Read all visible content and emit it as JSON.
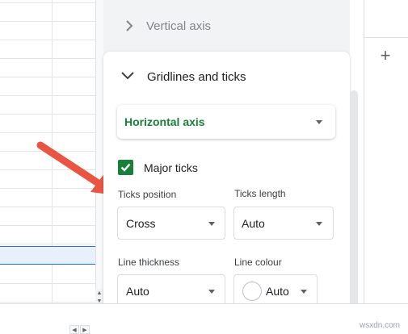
{
  "editor": {
    "vertical_axis_section": "Vertical axis",
    "gridlines_section": "Gridlines and ticks",
    "axis_select_value": "Horizontal axis",
    "major_ticks_label": "Major ticks",
    "major_ticks_checked": true,
    "ticks_position": {
      "label": "Ticks position",
      "value": "Cross"
    },
    "ticks_length": {
      "label": "Ticks length",
      "value": "Auto"
    },
    "line_thickness": {
      "label": "Line thickness",
      "value": "Auto"
    },
    "line_colour": {
      "label": "Line colour",
      "value": "Auto",
      "swatch": "#ffffff"
    }
  },
  "colors": {
    "accent_green": "#188038",
    "annotation_arrow": "#ea5543",
    "selection_blue": "#1a73e8"
  },
  "icons": [
    "chevron-right-icon",
    "chevron-down-icon",
    "dropdown-caret-icon",
    "checkmark-icon",
    "plus-icon"
  ],
  "watermark": "wsxdn.com"
}
